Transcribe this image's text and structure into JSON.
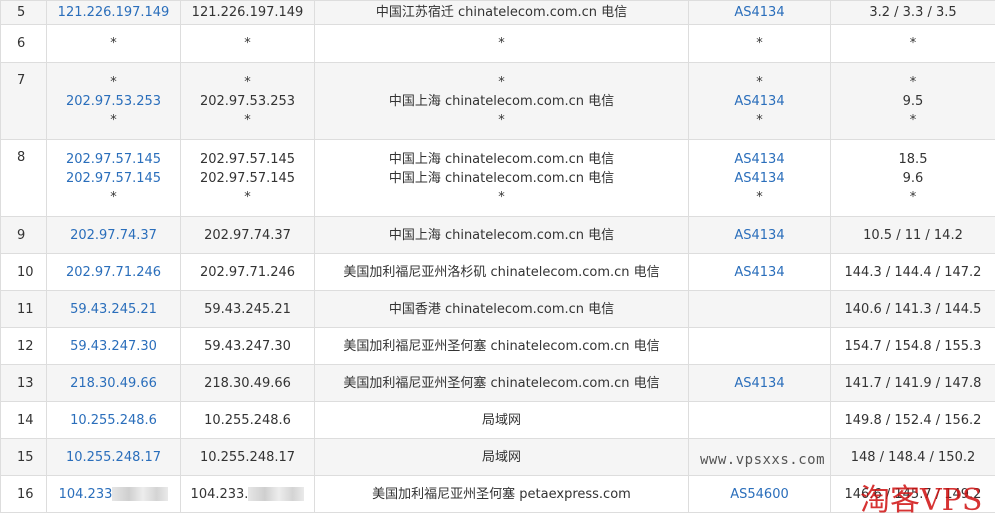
{
  "rows": [
    {
      "hop": "5",
      "ips": [
        "121.226.197.149"
      ],
      "hosts": [
        "121.226.197.149"
      ],
      "locs": [
        "中国江苏宿迁 chinatelecom.com.cn 电信"
      ],
      "asns": [
        "AS4134"
      ],
      "times": [
        "3.2 / 3.3 / 3.5"
      ]
    },
    {
      "hop": "6",
      "ips": [
        "*"
      ],
      "hosts": [
        "*"
      ],
      "locs": [
        "*"
      ],
      "asns": [
        "*"
      ],
      "times": [
        "*"
      ]
    },
    {
      "hop": "7",
      "ips": [
        "*",
        "202.97.53.253",
        "*"
      ],
      "hosts": [
        "*",
        "202.97.53.253",
        "*"
      ],
      "locs": [
        "*",
        "中国上海 chinatelecom.com.cn 电信",
        "*"
      ],
      "asns": [
        "*",
        "AS4134",
        "*"
      ],
      "times": [
        "*",
        "9.5",
        "*"
      ]
    },
    {
      "hop": "8",
      "ips": [
        "202.97.57.145",
        "202.97.57.145",
        "*"
      ],
      "hosts": [
        "202.97.57.145",
        "202.97.57.145",
        "*"
      ],
      "locs": [
        "中国上海 chinatelecom.com.cn 电信",
        "中国上海 chinatelecom.com.cn 电信",
        "*"
      ],
      "asns": [
        "AS4134",
        "AS4134",
        "*"
      ],
      "times": [
        "18.5",
        "9.6",
        "*"
      ]
    },
    {
      "hop": "9",
      "ips": [
        "202.97.74.37"
      ],
      "hosts": [
        "202.97.74.37"
      ],
      "locs": [
        "中国上海 chinatelecom.com.cn 电信"
      ],
      "asns": [
        "AS4134"
      ],
      "times": [
        "10.5 / 11 / 14.2"
      ]
    },
    {
      "hop": "10",
      "ips": [
        "202.97.71.246"
      ],
      "hosts": [
        "202.97.71.246"
      ],
      "locs": [
        "美国加利福尼亚州洛杉矶 chinatelecom.com.cn 电信"
      ],
      "asns": [
        "AS4134"
      ],
      "times": [
        "144.3 / 144.4 / 147.2"
      ]
    },
    {
      "hop": "11",
      "ips": [
        "59.43.245.21"
      ],
      "hosts": [
        "59.43.245.21"
      ],
      "locs": [
        "中国香港 chinatelecom.com.cn 电信"
      ],
      "asns": [
        ""
      ],
      "times": [
        "140.6 / 141.3 / 144.5"
      ]
    },
    {
      "hop": "12",
      "ips": [
        "59.43.247.30"
      ],
      "hosts": [
        "59.43.247.30"
      ],
      "locs": [
        "美国加利福尼亚州圣何塞 chinatelecom.com.cn 电信"
      ],
      "asns": [
        ""
      ],
      "times": [
        "154.7 / 154.8 / 155.3"
      ]
    },
    {
      "hop": "13",
      "ips": [
        "218.30.49.66"
      ],
      "hosts": [
        "218.30.49.66"
      ],
      "locs": [
        "美国加利福尼亚州圣何塞 chinatelecom.com.cn 电信"
      ],
      "asns": [
        "AS4134"
      ],
      "times": [
        "141.7 / 141.9 / 147.8"
      ]
    },
    {
      "hop": "14",
      "ips": [
        "10.255.248.6"
      ],
      "hosts": [
        "10.255.248.6"
      ],
      "locs": [
        "局域网"
      ],
      "asns": [
        ""
      ],
      "times": [
        "149.8 / 152.4 / 156.2"
      ]
    },
    {
      "hop": "15",
      "ips": [
        "10.255.248.17"
      ],
      "hosts": [
        "10.255.248.17"
      ],
      "locs": [
        "局域网"
      ],
      "asns": [
        ""
      ],
      "times": [
        "148 / 148.4 / 150.2"
      ]
    },
    {
      "hop": "16",
      "ips": [
        "104.233"
      ],
      "hosts": [
        "104.233."
      ],
      "locs": [
        "美国加利福尼亚州圣何塞 petaexpress.com"
      ],
      "asns": [
        "AS54600"
      ],
      "times": [
        "146.6 / 145.7 / 149.2"
      ],
      "redacted": true
    }
  ],
  "row_heights": [],
  "watermark": {
    "site": "www.vpsxxs.com",
    "logo": "淘客VPS"
  },
  "colors": {
    "link": "#2a6ebb",
    "border": "#dddddd",
    "odd_row": "#f5f5f5",
    "logo": "#d01010"
  }
}
